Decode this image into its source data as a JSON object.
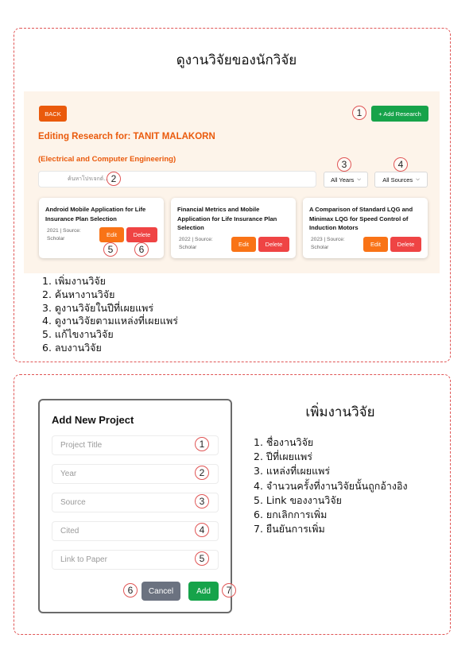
{
  "section1": {
    "title": "ดูงานวิจัยของนักวิจัย",
    "screenshot": {
      "back_label": "BACK",
      "add_research_label": "+ Add Research",
      "editing_heading": "Editing Research for: TANIT MALAKORN",
      "department": "(Electrical and Computer Engineering)",
      "search_placeholder": "ค้นหาโปรเจกต์...",
      "year_filter": "All Years",
      "source_filter": "All Sources",
      "cards": [
        {
          "title": "Android Mobile Application for Life Insurance Plan Selection",
          "meta": "2021 | Source: Scholar",
          "edit_label": "Edit",
          "delete_label": "Delete"
        },
        {
          "title": "Financial Metrics and Mobile Application for Life Insurance Plan Selection",
          "meta": "2022 | Source: Scholar",
          "edit_label": "Edit",
          "delete_label": "Delete"
        },
        {
          "title": "A Comparison of Standard LQG and Minimax LQG for Speed Control of Induction Motors",
          "meta": "2023 | Source: Scholar",
          "edit_label": "Edit",
          "delete_label": "Delete"
        }
      ]
    },
    "markers": [
      "1",
      "2",
      "3",
      "4",
      "5",
      "6"
    ],
    "legend": [
      "1. เพิ่มงานวิจัย",
      "2. ค้นหางานวิจัย",
      "3. ดูงานวิจัยในปีที่เผยแพร่",
      "4. ดูงานวิจัยตามแหล่งที่เผยแพร่",
      "5. แก้ไขงานวิจัย",
      "6. ลบงานวิจัย"
    ]
  },
  "section2": {
    "title": "เพิ่มงานวิจัย",
    "dialog": {
      "title": "Add New Project",
      "fields": [
        "Project Title",
        "Year",
        "Source",
        "Cited",
        "Link to Paper"
      ],
      "cancel_label": "Cancel",
      "add_label": "Add"
    },
    "markers": [
      "1",
      "2",
      "3",
      "4",
      "5",
      "6",
      "7"
    ],
    "legend": [
      "1. ชื่องานวิจัย",
      "2. ปีที่เผยแพร่",
      "3. แหล่งที่เผยแพร่",
      "4. จำนวนครั้งที่งานวิจัยนั้นถูกอ้างอิง",
      "5. Link ของงานวิจัย",
      "6. ยกเลิกการเพิ่ม",
      "7. ยืนยันการเพิ่ม"
    ]
  },
  "colors": {
    "dashed_border": "#e05555",
    "brand_orange": "#ea5a0c",
    "add_green": "#16a34a",
    "edit_orange": "#f97316",
    "delete_red": "#ef4444",
    "cancel_gray": "#6b7280",
    "panel_bg": "#fdf4ea"
  }
}
